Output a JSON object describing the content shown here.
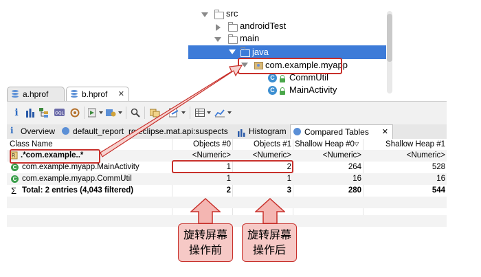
{
  "tree": {
    "src": "src",
    "androidTest": "androidTest",
    "main": "main",
    "java": "java",
    "package": "com.example.myapp",
    "class1": "CommUtil",
    "class2": "MainActivity"
  },
  "editor_tabs": [
    {
      "label": "a.hprof",
      "active": false
    },
    {
      "label": "b.hprof",
      "active": true
    }
  ],
  "toolbar": {
    "icons": [
      "info-icon",
      "histogram-icon",
      "dominator-tree-icon",
      "oql-icon",
      "thread-icon",
      "run-report-icon",
      "query-browser-icon",
      "search-icon",
      "copy-icon",
      "export-icon",
      "table-view-icon",
      "chart-icon"
    ]
  },
  "result_tabs": [
    {
      "label": "Overview"
    },
    {
      "label": "default_report"
    },
    {
      "label": "rg.eclipse.mat.api:suspects"
    },
    {
      "label": "Histogram"
    },
    {
      "label": "Compared Tables"
    }
  ],
  "table": {
    "headers": [
      "Class Name",
      "Objects #0",
      "Objects #1",
      "Shallow Heap #0",
      "Shallow Heap #1"
    ],
    "filter_row": {
      "name": ".*com.example..*",
      "c1": "<Numeric>",
      "c2": "<Numeric>",
      "c3": "<Numeric>",
      "c4": "<Numeric>"
    },
    "rows": [
      {
        "name": "com.example.myapp.MainActivity",
        "c1": "1",
        "c2": "2",
        "c3": "264",
        "c4": "528"
      },
      {
        "name": "com.example.myapp.CommUtil",
        "c1": "1",
        "c2": "1",
        "c3": "16",
        "c4": "16"
      }
    ],
    "total": {
      "name": "Total: 2 entries (4,043 filtered)",
      "c1": "2",
      "c2": "3",
      "c3": "280",
      "c4": "544"
    }
  },
  "annotations": {
    "before_line1": "旋转屏幕",
    "before_line2": "操作前",
    "after_line1": "旋转屏幕",
    "after_line2": "操作后",
    "accent_red": "#c8302b",
    "arrow_fill": "#f4b6b2"
  }
}
